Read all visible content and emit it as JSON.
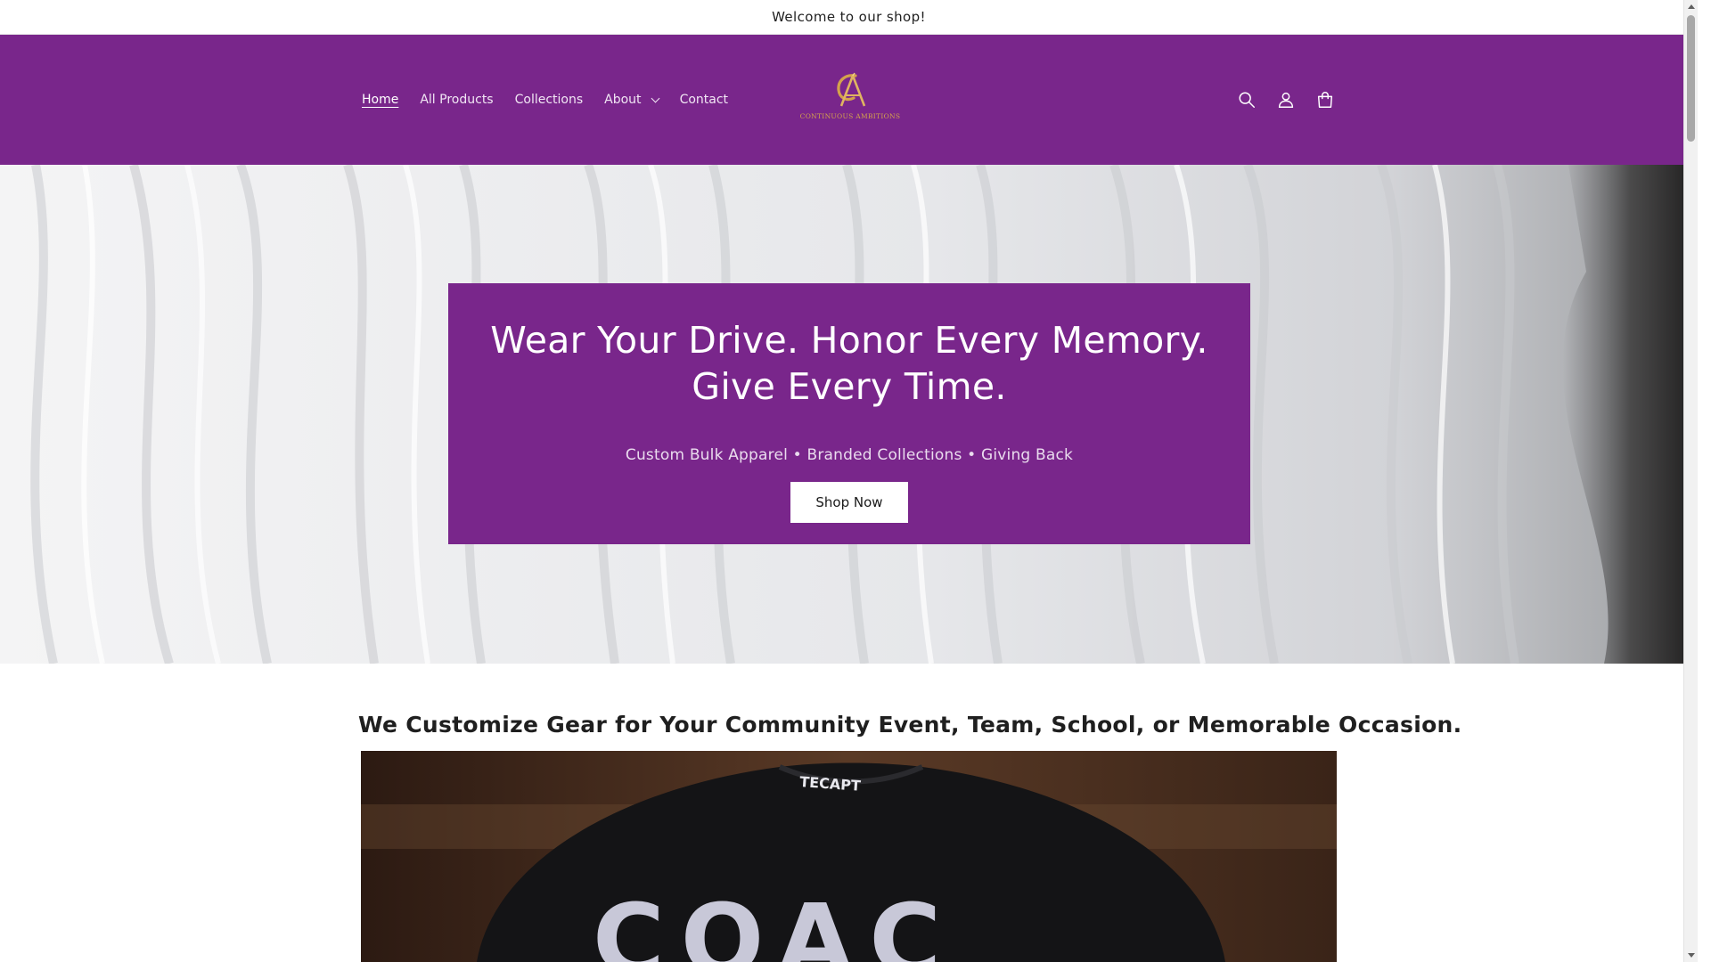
{
  "announcement": {
    "text": "Welcome to our shop!"
  },
  "header": {
    "nav": [
      {
        "label": "Home",
        "active": true
      },
      {
        "label": "All Products"
      },
      {
        "label": "Collections"
      },
      {
        "label": "About",
        "has_dropdown": true
      },
      {
        "label": "Contact"
      }
    ],
    "logo": {
      "monogram": "CA",
      "text": "CONTINUOUS AMBITIONS"
    },
    "icons": [
      "search-icon",
      "account-icon",
      "cart-icon"
    ],
    "background_color": "#79268b"
  },
  "hero": {
    "title": "Wear Your Drive. Honor Every Memory. Give Every Time.",
    "subtitle": "Custom Bulk Apparel  •  Branded Collections  •  Giving Back",
    "button_label": "Shop Now"
  },
  "section": {
    "tagline": "We Customize Gear for Your Community Event, Team, School, or Memorable Occasion."
  },
  "colors": {
    "brand_purple": "#79268b",
    "logo_gold": "#d4a24c"
  }
}
